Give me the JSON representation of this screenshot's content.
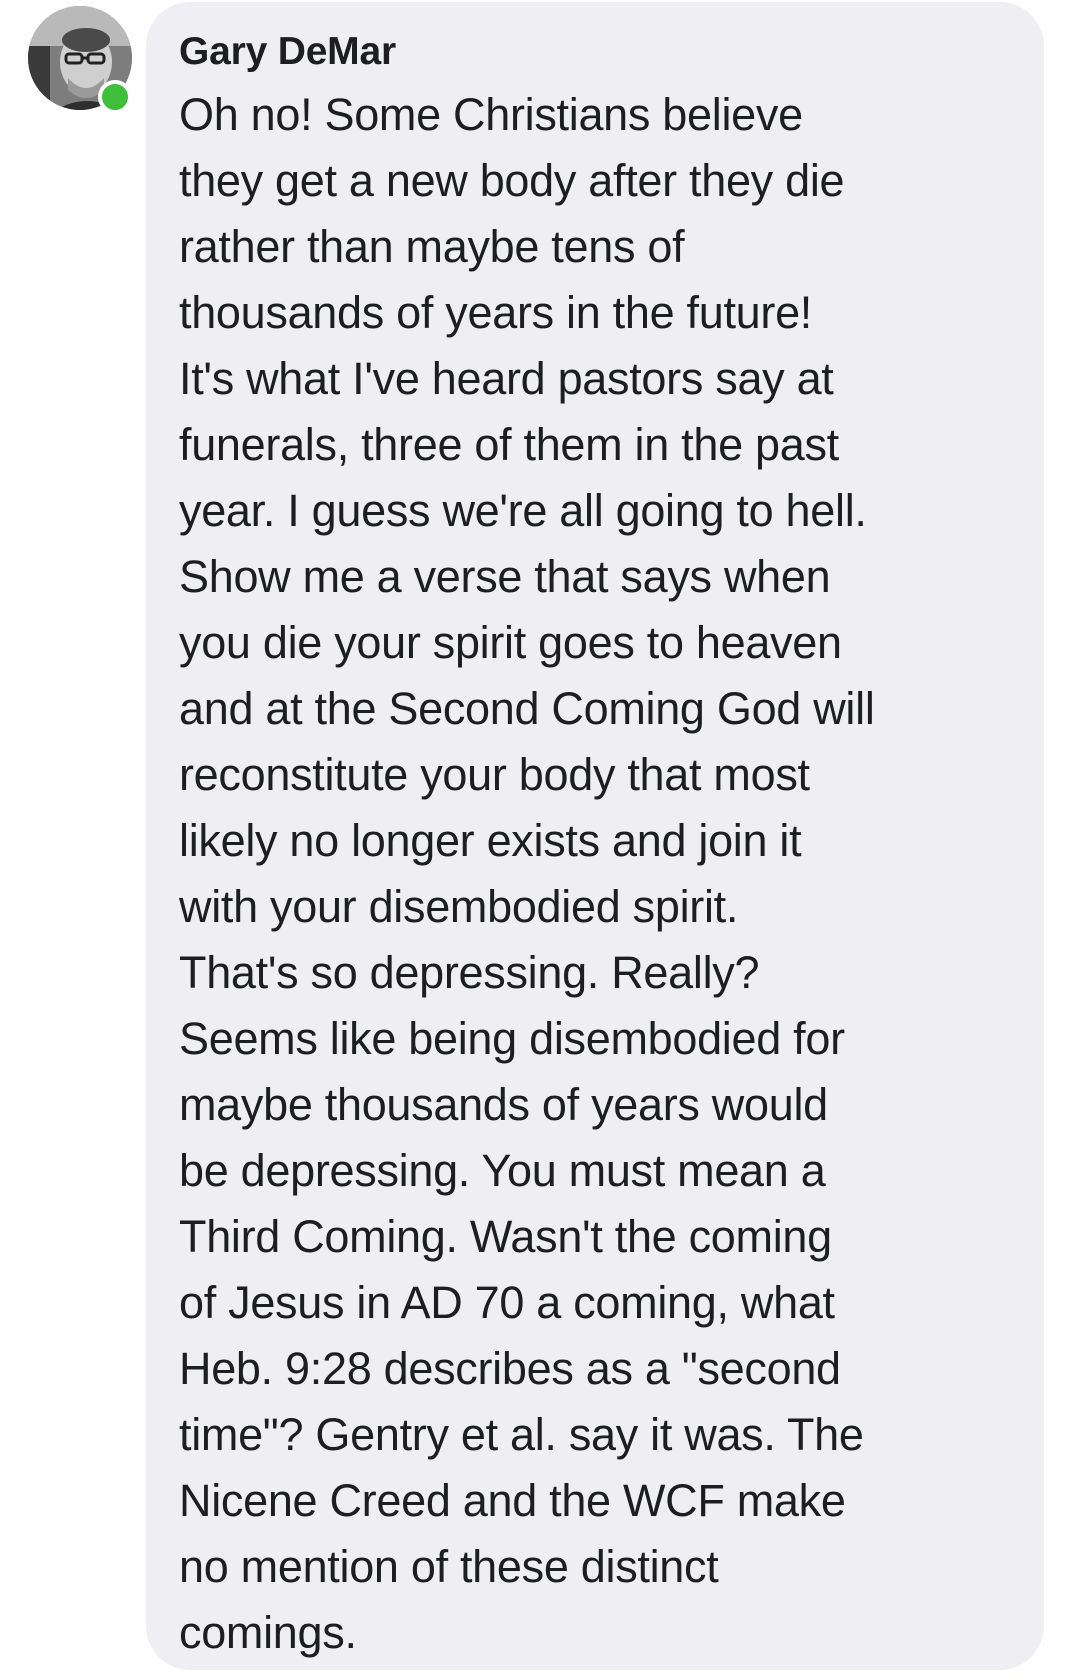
{
  "comment": {
    "author": "Gary DeMar",
    "author_online": true,
    "avatar_icon": "profile-photo",
    "lines": [
      "Oh no! Some Christians believe",
      "they get a new body after they die",
      "rather than maybe tens of",
      "thousands of years in the future!",
      "It's what I've heard pastors say at",
      "funerals, three of them in the past",
      "year. I guess we're all going to hell.",
      "Show me a verse that says when",
      "you die your spirit goes to heaven",
      "and at the Second Coming God will",
      "reconstitute your body that most",
      "likely no longer exists and join it",
      "with your disembodied spirit.",
      "That's so depressing. Really?",
      "Seems like being disembodied for",
      "maybe thousands of years would",
      "be depressing. You must mean a",
      "Third Coming. Wasn't the coming",
      "of Jesus in AD 70 a coming, what",
      "Heb. 9:28 describes as a \"second",
      "time\"? Gentry et al. say it was. The",
      "Nicene Creed and the WCF make",
      "no mention of these distinct",
      "comings."
    ]
  },
  "colors": {
    "bubble_background": "#efeff3",
    "text": "#1c1e21",
    "online_indicator": "#3fbe3a"
  }
}
